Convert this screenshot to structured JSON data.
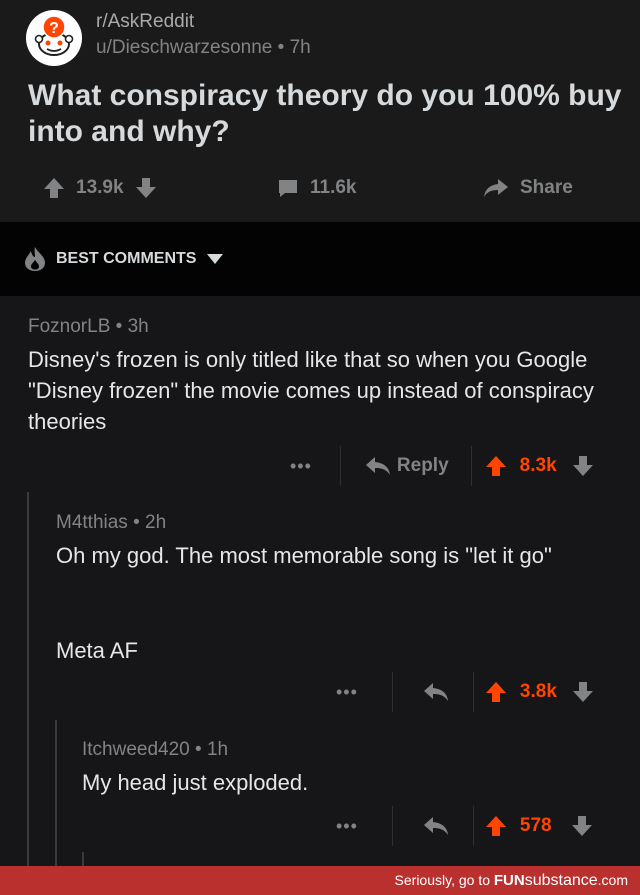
{
  "post": {
    "subreddit": "r/AskReddit",
    "meta": "u/Dieschwarzesonne • 7h",
    "title": "What conspiracy theory do you 100% buy into and why?",
    "score": "13.9k",
    "comments": "11.6k",
    "share": "Share"
  },
  "sort_label": "BEST COMMENTS",
  "comments": [
    {
      "author": "FoznorLB • 3h",
      "text": "Disney's frozen is only titled like that so when you Google \"Disney frozen\" the movie comes up instead of conspiracy theories",
      "dots": "•••",
      "reply": "Reply",
      "score": "8.3k"
    },
    {
      "author": "M4tthias • 2h",
      "text_1": "Oh my god. The most memorable song is \"let it go\"",
      "text_2": "Meta AF",
      "dots": "•••",
      "score": "3.8k"
    },
    {
      "author": "Itchweed420 • 1h",
      "text": "My head just exploded.",
      "dots": "•••",
      "score": "578"
    }
  ],
  "footer": {
    "text": "Seriously, go to ",
    "brand_1": "FUN",
    "brand_2": "substance",
    "brand_3": ".com"
  },
  "colors": {
    "upvote": "#ff4500",
    "background": "#161618",
    "footer": "#b9302f"
  },
  "icons": [
    "reddit-snoo-icon",
    "upvote-arrow-icon",
    "downvote-arrow-icon",
    "comment-bubble-icon",
    "share-arrow-icon",
    "flame-icon",
    "caret-down-icon",
    "reply-arrow-icon"
  ]
}
